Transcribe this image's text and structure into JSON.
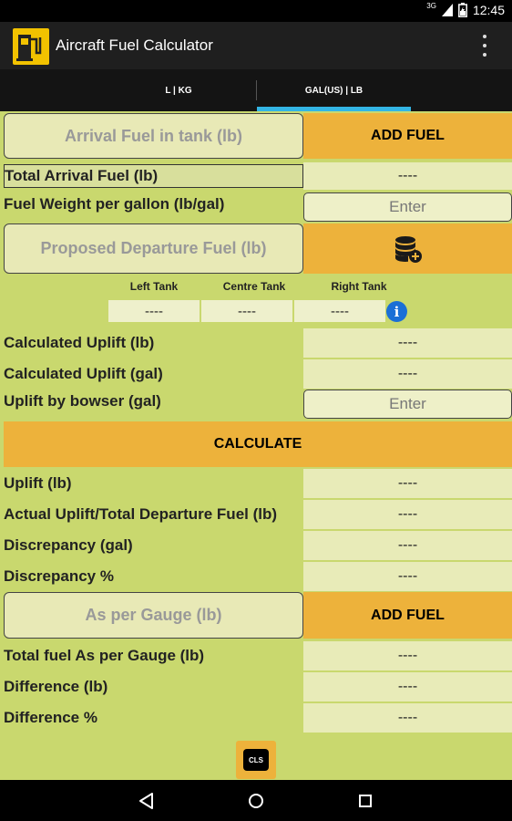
{
  "status_bar": {
    "network": "3G",
    "time": "12:45"
  },
  "app_bar": {
    "title": "Aircraft Fuel Calculator"
  },
  "tabs": [
    {
      "label": "L | KG",
      "selected": false
    },
    {
      "label": "GAL(US) | LB",
      "selected": true
    }
  ],
  "colors": {
    "accent": "#33b5e5",
    "content_bg": "#c9d86e",
    "orange": "#edb23b",
    "value_bg": "#e8ebb8"
  },
  "arrival": {
    "button_label": "Arrival Fuel in tank (lb)",
    "add_fuel_label": "ADD FUEL"
  },
  "total_arrival": {
    "label": "Total Arrival Fuel (lb)",
    "value": "----"
  },
  "fuel_weight": {
    "label": "Fuel Weight per gallon (lb/gal)",
    "placeholder": "Enter"
  },
  "proposed": {
    "button_label": "Proposed Departure Fuel (lb)",
    "icon": "database-add-icon"
  },
  "tanks": {
    "headers": [
      "Left Tank",
      "Centre Tank",
      "Right Tank"
    ],
    "values": [
      "----",
      "----",
      "----"
    ],
    "info_symbol": "i"
  },
  "calc_uplift_lb": {
    "label": "Calculated Uplift (lb)",
    "value": "----"
  },
  "calc_uplift_gal": {
    "label": "Calculated Uplift (gal)",
    "value": "----"
  },
  "bowser": {
    "label": "Uplift by bowser (gal)",
    "placeholder": "Enter"
  },
  "calculate": {
    "label": "CALCULATE"
  },
  "uplift_lb": {
    "label": "Uplift (lb)",
    "value": "----"
  },
  "actual": {
    "label": "Actual Uplift/Total Departure Fuel (lb)",
    "value": "----"
  },
  "discrepancy_gal": {
    "label": "Discrepancy (gal)",
    "value": "----"
  },
  "discrepancy_pct": {
    "label": "Discrepancy %",
    "value": "----"
  },
  "gauge": {
    "button_label": "As per Gauge (lb)",
    "add_fuel_label": "ADD FUEL"
  },
  "total_gauge": {
    "label": "Total fuel As per Gauge (lb)",
    "value": "----"
  },
  "difference_lb": {
    "label": "Difference (lb)",
    "value": "----"
  },
  "difference_pct": {
    "label": "Difference %",
    "value": "----"
  },
  "cls": {
    "label": "CLS"
  }
}
